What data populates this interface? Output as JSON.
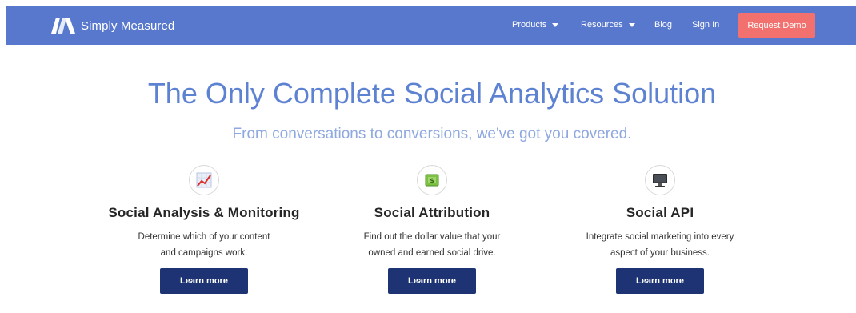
{
  "header": {
    "brand": "Simply Measured",
    "nav": [
      {
        "label": "Products",
        "has_dropdown": true
      },
      {
        "label": "Resources",
        "has_dropdown": true
      },
      {
        "label": "Blog",
        "has_dropdown": false
      },
      {
        "label": "Sign In",
        "has_dropdown": false
      }
    ],
    "cta_label": "Request Demo"
  },
  "hero": {
    "title": "The Only Complete Social Analytics Solution",
    "subtitle": "From conversations to conversions, we've got you covered."
  },
  "features": [
    {
      "icon": "line-chart-icon",
      "title": "Social Analysis & Monitoring",
      "desc_line1": "Determine which of your content",
      "desc_line2": "and campaigns work.",
      "button": "Learn more"
    },
    {
      "icon": "dollar-bill-icon",
      "title": "Social Attribution",
      "desc_line1": "Find out the dollar value that your",
      "desc_line2": "owned and earned social drive.",
      "button": "Learn more"
    },
    {
      "icon": "monitor-icon",
      "title": "Social API",
      "desc_line1": "Integrate social marketing into every",
      "desc_line2": "aspect of your business.",
      "button": "Learn more"
    }
  ],
  "colors": {
    "header_bg": "#5778cc",
    "cta_bg": "#f2706d",
    "title": "#5e82d2",
    "subtitle": "#8ea8e0",
    "button_bg": "#1e3373"
  }
}
